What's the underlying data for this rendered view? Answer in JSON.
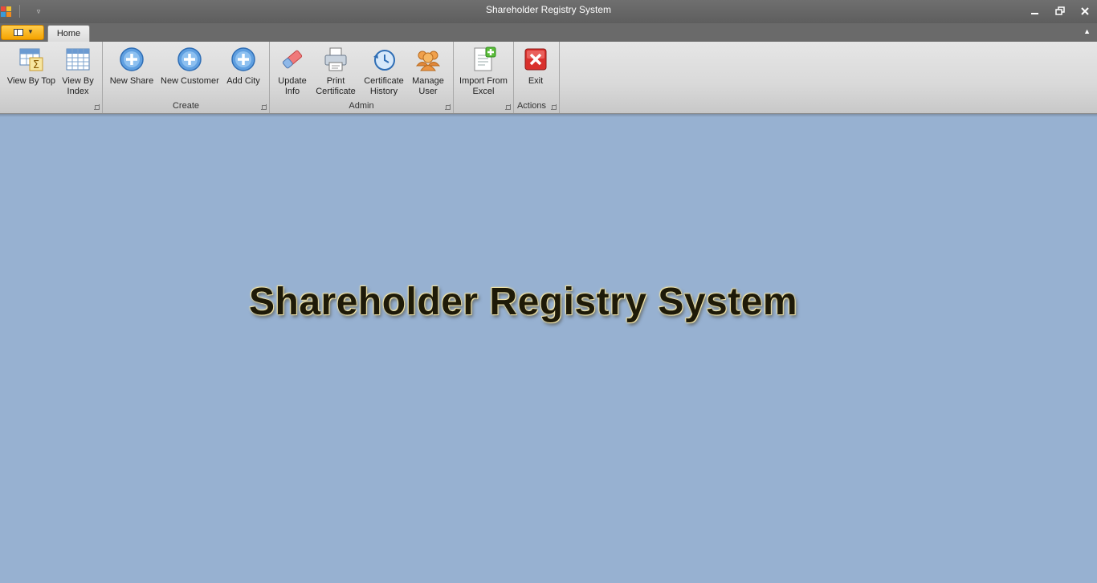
{
  "window": {
    "title": "Shareholder Registry System",
    "minimize_icon": "minimize-icon",
    "restore_icon": "restore-icon",
    "close_icon": "close-icon"
  },
  "tabs": [
    {
      "label": "Home",
      "selected": true
    }
  ],
  "ribbon": {
    "groups": [
      {
        "label": "",
        "buttons": [
          {
            "label": "View By Top",
            "icon": "sum-grid-icon"
          },
          {
            "label": "View By Index",
            "icon": "grid-icon"
          }
        ]
      },
      {
        "label": "Create",
        "buttons": [
          {
            "label": "New Share",
            "icon": "add-circle-icon"
          },
          {
            "label": "New Customer",
            "icon": "add-circle-icon"
          },
          {
            "label": "Add City",
            "icon": "add-circle-icon"
          }
        ]
      },
      {
        "label": "Admin",
        "buttons": [
          {
            "label": "Update Info",
            "icon": "eraser-icon"
          },
          {
            "label": "Print Certificate",
            "icon": "printer-icon"
          },
          {
            "label": "Certificate History",
            "icon": "history-icon"
          },
          {
            "label": "Manage User",
            "icon": "users-icon"
          }
        ]
      },
      {
        "label": "",
        "buttons": [
          {
            "label": "Import From Excel",
            "icon": "import-document-icon"
          }
        ]
      },
      {
        "label": "Actions",
        "buttons": [
          {
            "label": "Exit",
            "icon": "exit-icon"
          }
        ]
      }
    ]
  },
  "main": {
    "banner": "Shareholder Registry System"
  },
  "colors": {
    "background": "#97b1d1",
    "app_menu": "#f5a300",
    "exit": "#d9302c"
  }
}
